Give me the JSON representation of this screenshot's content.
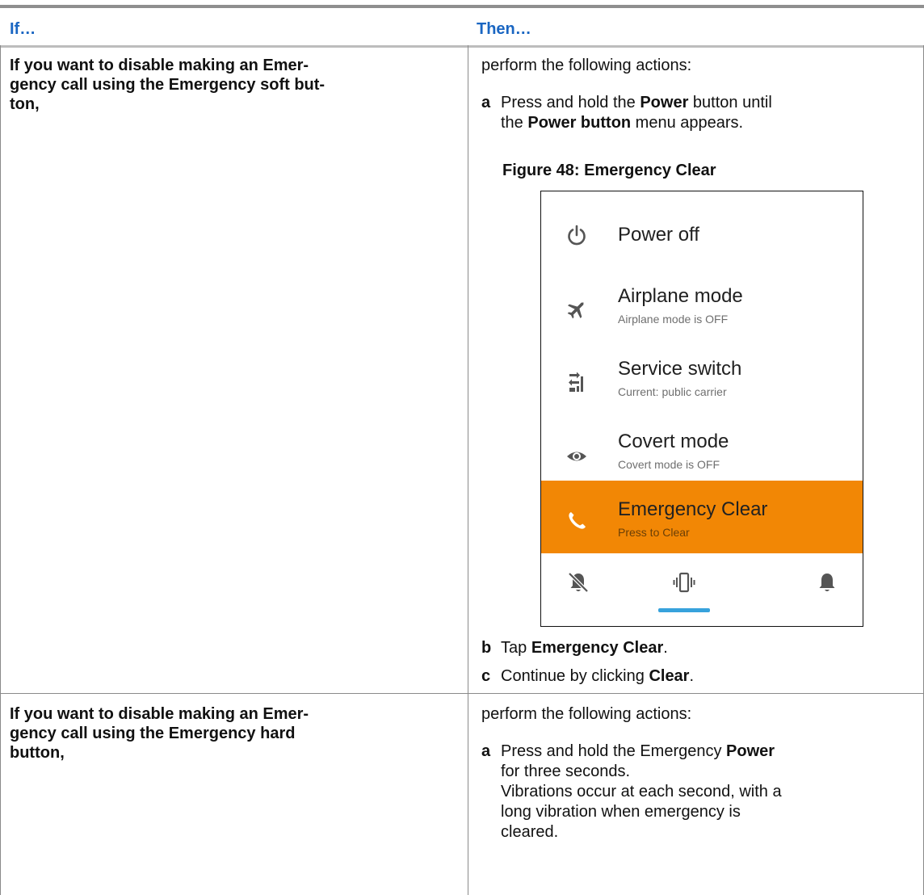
{
  "header": {
    "col_if": "If…",
    "col_then": "Then…"
  },
  "rows": [
    {
      "condition": [
        "If you want to disable making an Emer-",
        "gency call using the Emergency soft but-",
        "ton,"
      ],
      "intro": "perform the following actions:",
      "step_a": {
        "letter": "a",
        "pre": "Press and hold the ",
        "bold1": "Power",
        "mid": " button until",
        "line2_pre": "the ",
        "bold2": "Power button",
        "line2_post": " menu appears."
      },
      "figure_title": "Figure 48: Emergency Clear",
      "step_b": {
        "letter": "b",
        "pre": "Tap ",
        "bold": "Emergency Clear",
        "post": "."
      },
      "step_c": {
        "letter": "c",
        "pre": "Continue by clicking ",
        "bold": "Clear",
        "post": "."
      }
    },
    {
      "condition": [
        "If you want to disable making an Emer-",
        "gency call using the Emergency hard",
        "button,"
      ],
      "intro": "perform the following actions:",
      "step_a": {
        "letter": "a",
        "pre": "Press and hold the Emergency ",
        "bold": "Power",
        "line2": "for three seconds.",
        "line3": "Vibrations occur at each second, with a",
        "line4": "long vibration when emergency is",
        "line5": "cleared."
      }
    }
  ],
  "phone_menu": {
    "items": [
      {
        "label": "Power off",
        "sub": "",
        "icon": "power-icon"
      },
      {
        "label": "Airplane mode",
        "sub": "Airplane mode is OFF",
        "icon": "airplane-icon"
      },
      {
        "label": "Service switch",
        "sub": "Current: public carrier",
        "icon": "service-switch-icon"
      },
      {
        "label": "Covert mode",
        "sub": "Covert mode is OFF",
        "icon": "eye-icon"
      },
      {
        "label": "Emergency Clear",
        "sub": "Press to Clear",
        "icon": "phone-icon",
        "highlighted": true
      }
    ],
    "sound_modes": [
      "mute-bell-icon",
      "vibrate-icon",
      "bell-icon"
    ],
    "selected_sound_mode": "vibrate-icon"
  },
  "colors": {
    "header_text": "#1a66c2",
    "highlight": "#f28705",
    "underline": "#37a2dc"
  }
}
